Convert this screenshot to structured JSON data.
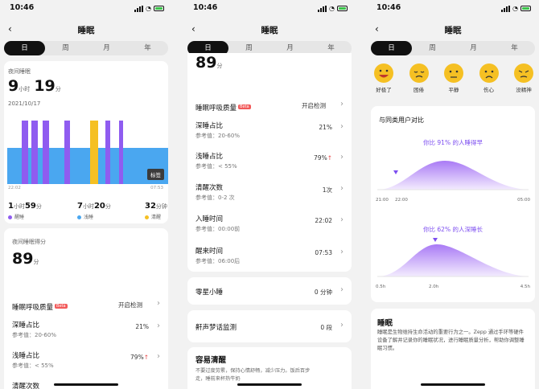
{
  "status": {
    "time": "10:46"
  },
  "header": {
    "title": "睡眠",
    "back": "‹"
  },
  "tabs": [
    "日",
    "周",
    "月",
    "年"
  ],
  "screen1": {
    "night_label": "夜间睡眠",
    "hours": "9",
    "hours_unit": "小时",
    "minutes": "19",
    "minutes_unit": "分",
    "date": "2021/10/17",
    "chart_data": {
      "type": "bar",
      "x_start": "22:02",
      "x_end": "07:53",
      "tag_button": "标签",
      "series": [
        {
          "name": "醒睡",
          "color": "#8f5cf0"
        },
        {
          "name": "浅睡",
          "color": "#4aa7f0"
        },
        {
          "name": "清醒",
          "color": "#f5c023"
        }
      ]
    },
    "stats": [
      {
        "v1": "1",
        "u1": "小时",
        "v2": "59",
        "u2": "分",
        "label": "醒睡",
        "color": "#8f5cf0"
      },
      {
        "v1": "7",
        "u1": "小时",
        "v2": "20",
        "u2": "分",
        "label": "浅睡",
        "color": "#4aa7f0"
      },
      {
        "v1": "32",
        "u1": "分钟",
        "v2": "",
        "u2": "",
        "label": "清醒",
        "color": "#f5c023"
      }
    ],
    "score_label": "夜间睡眠得分",
    "score": "89",
    "score_unit": "分",
    "breath_label": "睡眠呼吸质量",
    "beta": "Beta",
    "breath_value": "开启检测",
    "deep_label": "深睡占比",
    "deep_ref": "参考值：20-60%",
    "deep_value": "21%",
    "light_label": "浅睡占比",
    "light_ref": "参考值：< 55%",
    "light_value": "79%",
    "up_arrow": "↑",
    "cut_label": "清醒次数"
  },
  "screen2": {
    "score": "89",
    "score_unit": "分",
    "rows": [
      {
        "label": "睡眠呼吸质量",
        "ref": "",
        "value": "开启检测",
        "beta": "Beta"
      },
      {
        "label": "深睡占比",
        "ref": "参考值：20-60%",
        "value": "21%"
      },
      {
        "label": "浅睡占比",
        "ref": "参考值：< 55%",
        "value": "79%",
        "arrow": "↑"
      },
      {
        "label": "清醒次数",
        "ref": "参考值：0-2 次",
        "value": "1次"
      },
      {
        "label": "入睡时间",
        "ref": "参考值：00:00前",
        "value": "22:02"
      },
      {
        "label": "醒来时间",
        "ref": "参考值：06:00后",
        "value": "07:53"
      }
    ],
    "nap_label": "零星小睡",
    "nap_value": "0 分钟",
    "snore_label": "鼾声梦话监测",
    "snore_value": "0 段",
    "tip_title": "容易清醒",
    "tip_text1": "不要过度劳累，保持心情舒畅，减少压力。饭后百步",
    "tip_text2": "走，睡前来杯热牛奶"
  },
  "screen3": {
    "faces": [
      "好极了",
      "困倦",
      "平静",
      "伤心",
      "没精神"
    ],
    "compare_title": "与同类用户对比",
    "c1_title": "你比 91% 的人睡得早",
    "c1_ticks": [
      "21:00",
      "22:00",
      "05:00"
    ],
    "c2_title": "你比 62% 的人深睡长",
    "c2_ticks": [
      "0.5h",
      "2.0h",
      "4.5h"
    ],
    "info_title": "睡眠",
    "info_text": "睡眠是生物维持生命活动的重要行为之一。Zepp 通过手环等硬件设备了解并记录你的睡眠状况，进行睡眠质量分析，帮助你调整睡眠习惯。"
  }
}
